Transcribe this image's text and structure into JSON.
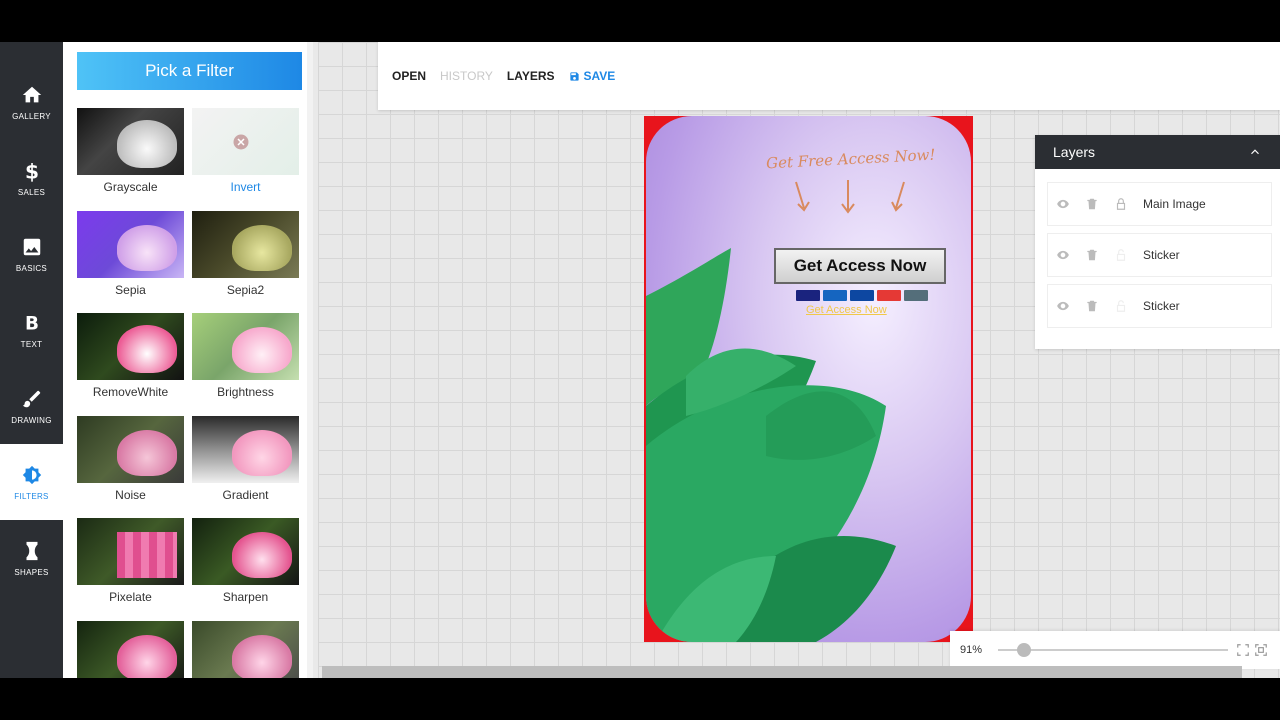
{
  "nav": {
    "items": [
      {
        "label": "GALLERY",
        "icon": "home-icon"
      },
      {
        "label": "SALES",
        "icon": "dollar-icon"
      },
      {
        "label": "BASICS",
        "icon": "image-icon"
      },
      {
        "label": "TEXT",
        "icon": "bold-icon"
      },
      {
        "label": "DRAWING",
        "icon": "brush-icon"
      },
      {
        "label": "FILTERS",
        "icon": "filter-icon"
      },
      {
        "label": "SHAPES",
        "icon": "shape-icon"
      }
    ],
    "active": "FILTERS"
  },
  "filters": {
    "title": "Pick a Filter",
    "items": [
      {
        "name": "Grayscale"
      },
      {
        "name": "Invert"
      },
      {
        "name": "Sepia"
      },
      {
        "name": "Sepia2"
      },
      {
        "name": "RemoveWhite"
      },
      {
        "name": "Brightness"
      },
      {
        "name": "Noise"
      },
      {
        "name": "Gradient"
      },
      {
        "name": "Pixelate"
      },
      {
        "name": "Sharpen"
      }
    ],
    "selected": "Invert"
  },
  "toolbar": {
    "open": "OPEN",
    "history": "HISTORY",
    "layers": "LAYERS",
    "save": "SAVE"
  },
  "canvas": {
    "headline": "Get Free Access Now!",
    "cta_button": "Get Access Now",
    "cta_link": "Get Access Now",
    "card_colors": [
      "#1a237e",
      "#1565c0",
      "#0d47a1",
      "#e53935",
      "#546e7a"
    ]
  },
  "layers": {
    "title": "Layers",
    "items": [
      {
        "name": "Main Image"
      },
      {
        "name": "Sticker"
      },
      {
        "name": "Sticker"
      }
    ]
  },
  "zoom": {
    "value_label": "91%",
    "value": 0.91
  },
  "colors": {
    "accent": "#1e88e5",
    "nav_bg": "#2b2e33",
    "artboard_border": "#e8141c"
  }
}
